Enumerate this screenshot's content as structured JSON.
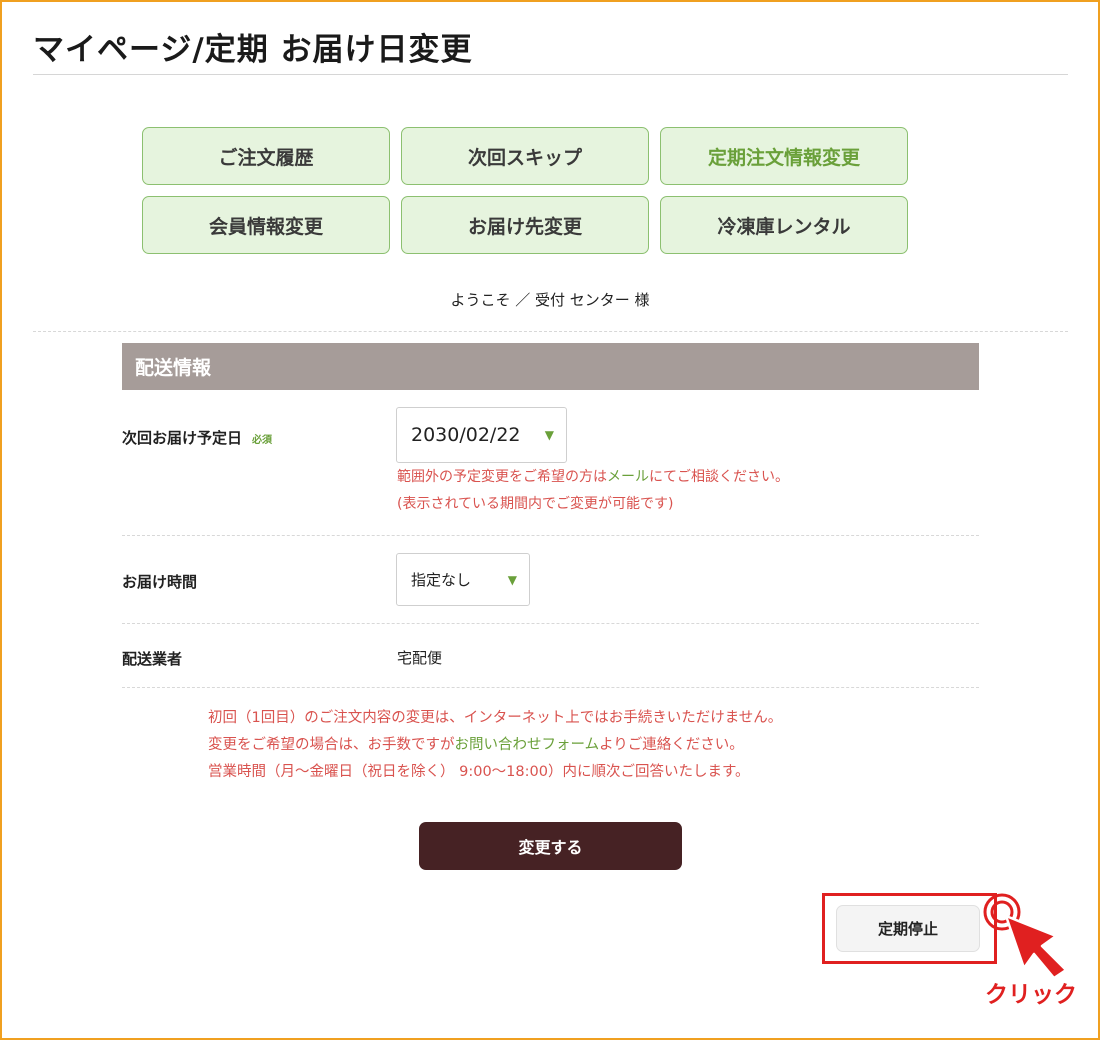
{
  "page": {
    "title": "マイページ/定期 お届け日変更"
  },
  "nav": {
    "items": [
      {
        "label": "ご注文履歴"
      },
      {
        "label": "次回スキップ"
      },
      {
        "label": "定期注文情報変更"
      },
      {
        "label": "会員情報変更"
      },
      {
        "label": "お届け先変更"
      },
      {
        "label": "冷凍庫レンタル"
      }
    ]
  },
  "welcome": "ようこそ ／ 受付 センター 様",
  "section": {
    "title": "配送情報"
  },
  "delivery_date": {
    "label": "次回お届け予定日",
    "required": "必須",
    "value": "2030/02/22",
    "note1_pre": "範囲外の予定変更をご希望の方は",
    "note1_link": "メール",
    "note1_post": "にてご相談ください。",
    "note2": "(表示されている期間内でご変更が可能です)"
  },
  "delivery_time": {
    "label": "お届け時間",
    "value": "指定なし"
  },
  "carrier": {
    "label": "配送業者",
    "value": "宅配便"
  },
  "notice": {
    "line1": "初回（1回目）のご注文内容の変更は、インターネット上ではお手続きいただけません。",
    "line2_pre": "変更をご希望の場合は、お手数ですが",
    "line2_link": "お問い合わせフォーム",
    "line2_post": "よりご連絡ください。",
    "line3": "営業時間（月～金曜日（祝日を除く） 9:00～18:00）内に順次ご回答いたします。"
  },
  "actions": {
    "submit_label": "変更する",
    "stop_label": "定期停止"
  },
  "annotation": {
    "click_label": "クリック"
  },
  "colors": {
    "accent_green": "#6aa03a",
    "alert_red": "#d9534f",
    "button_dark": "#462224",
    "highlight_red": "#e02020"
  }
}
